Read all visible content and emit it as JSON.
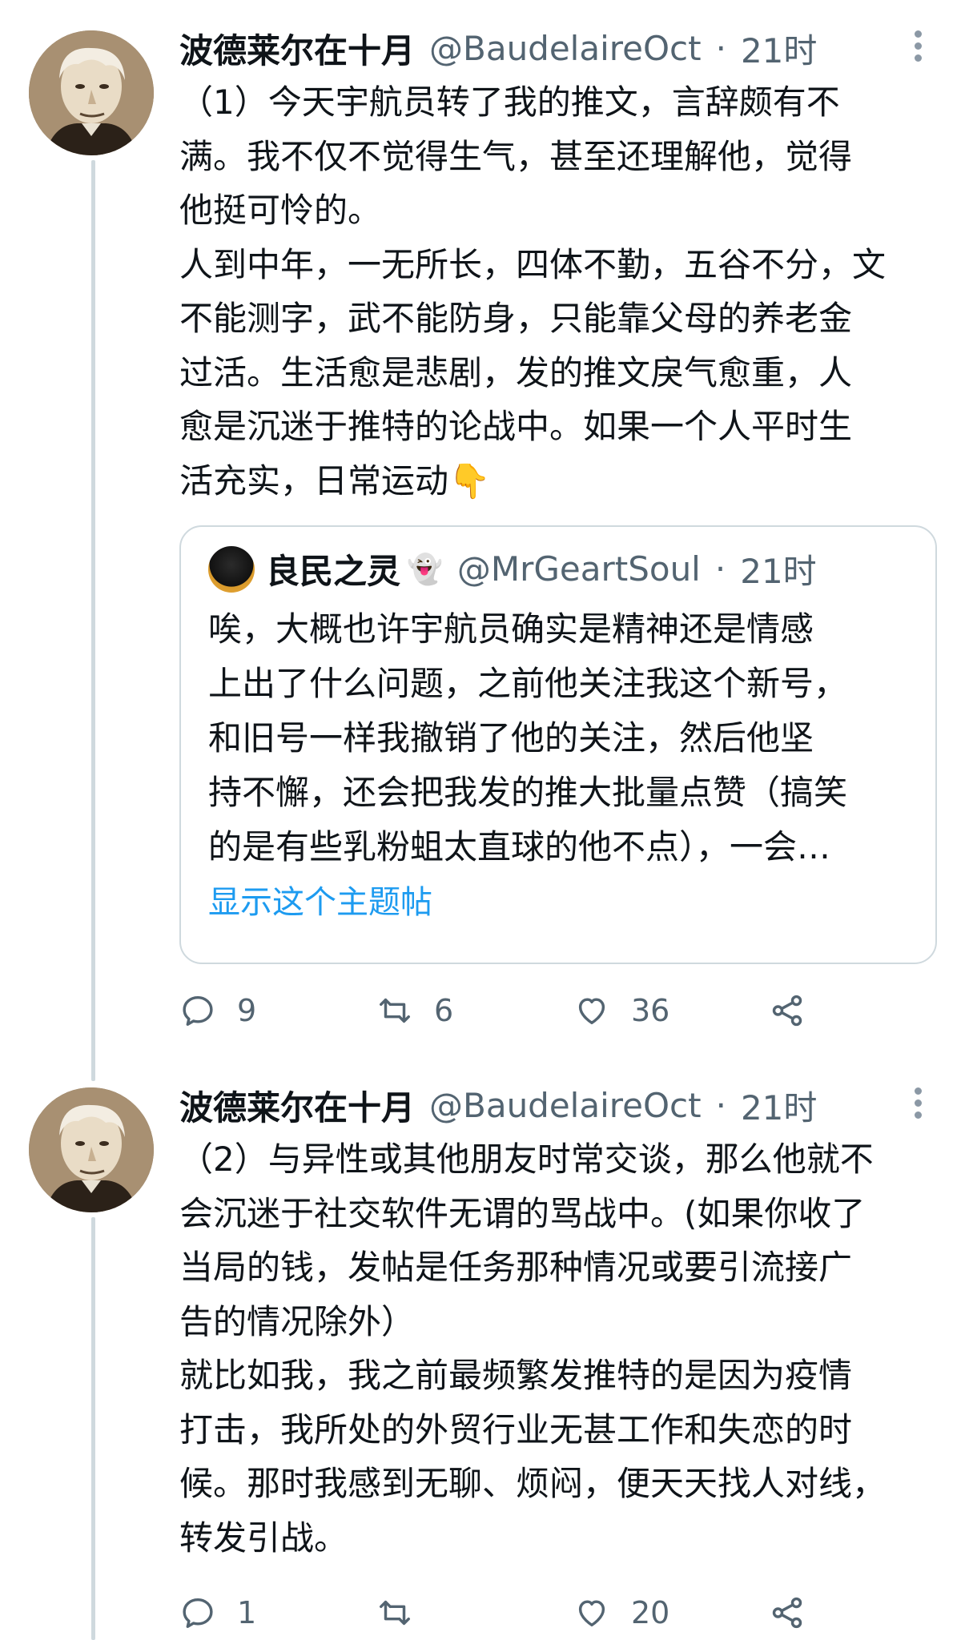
{
  "tweets": [
    {
      "display_name": "波德莱尔在十月",
      "handle": "@BaudelaireOct",
      "separator": "·",
      "time": "21时",
      "text": "（1）今天宇航员转了我的推文，言辞颇有不\n满。我不仅不觉得生气，甚至还理解他，觉得\n他挺可怜的。\n人到中年，一无所长，四体不勤，五谷不分，文\n不能测字，武不能防身，只能靠父母的养老金\n过活。生活愈是悲剧，发的推文戾气愈重，人\n愈是沉迷于推特的论战中。如果一个人平时生\n活充实，日常运动",
      "emoji": "👇",
      "reply_count": "9",
      "retweet_count": "6",
      "like_count": "36"
    },
    {
      "display_name": "波德莱尔在十月",
      "handle": "@BaudelaireOct",
      "separator": "·",
      "time": "21时",
      "text": "（2）与异性或其他朋友时常交谈，那么他就不\n会沉迷于社交软件无谓的骂战中。(如果你收了\n当局的钱，发帖是任务那种情况或要引流接广\n告的情况除外）\n就比如我，我之前最频繁发推特的是因为疫情\n打击，我所处的外贸行业无甚工作和失恋的时\n候。那时我感到无聊、烦闷，便天天找人对线，\n转发引战。",
      "reply_count": "1",
      "retweet_count": "",
      "like_count": "20"
    }
  ],
  "quote": {
    "display_name": "良民之灵",
    "handle": "@MrGeartSoul",
    "separator": "·",
    "time": "21时",
    "text": "唉，大概也许宇航员确实是精神还是情感\n上出了什么问题，之前他关注我这个新号，\n和旧号一样我撤销了他的关注，然后他坚\n持不懈，还会把我发的推大批量点赞（搞笑\n的是有些乳粉蛆太直球的他不点），一会…",
    "show_thread": "显示这个主题帖"
  },
  "icons": {
    "reply": "reply-icon",
    "retweet": "retweet-icon",
    "like": "heart-icon",
    "share": "share-icon",
    "more": "more-icon"
  },
  "colors": {
    "text": "#0f1419",
    "secondary": "#536471",
    "link": "#1d9bf0",
    "border": "#cfd9de"
  }
}
